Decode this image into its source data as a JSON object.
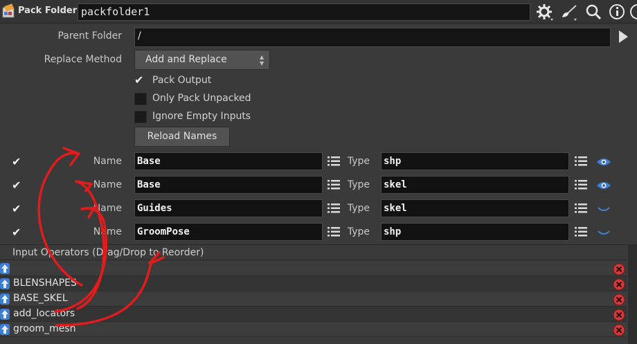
{
  "header": {
    "node_type": "Pack Folder",
    "node_name": "packfolder1",
    "icons": [
      "node-icon",
      "gear-icon",
      "brush-icon",
      "search-icon",
      "info-icon",
      "help-icon"
    ]
  },
  "params": {
    "parent_folder": {
      "label": "Parent Folder",
      "value": "/"
    },
    "replace_method": {
      "label": "Replace Method",
      "value": "Add and Replace"
    },
    "pack_output": {
      "label": "Pack Output",
      "checked": true
    },
    "only_pack_unpacked": {
      "label": "Only Pack Unpacked",
      "checked": false
    },
    "ignore_empty_inputs": {
      "label": "Ignore Empty Inputs",
      "checked": false
    },
    "reload_names": {
      "label": "Reload Names"
    }
  },
  "multiparm": {
    "name_label": "Name",
    "type_label": "Type",
    "rows": [
      {
        "enabled": true,
        "name": "Base",
        "type": "shp",
        "visible": true
      },
      {
        "enabled": true,
        "name": "Base",
        "type": "skel",
        "visible": true
      },
      {
        "enabled": true,
        "name": "Guides",
        "type": "skel",
        "visible": false
      },
      {
        "enabled": true,
        "name": "GroomPose",
        "type": "shp",
        "visible": false
      }
    ]
  },
  "inputs": {
    "header": "Input Operators (Drag/Drop to Reorder)",
    "items": [
      "",
      "BLENSHAPES",
      "BASE_SKEL",
      "add_locators",
      "groom_mesh"
    ]
  },
  "colors": {
    "accent_blue": "#3d7fd6",
    "delete_red": "#d23a3a",
    "annotation_red": "#e01c1c"
  }
}
